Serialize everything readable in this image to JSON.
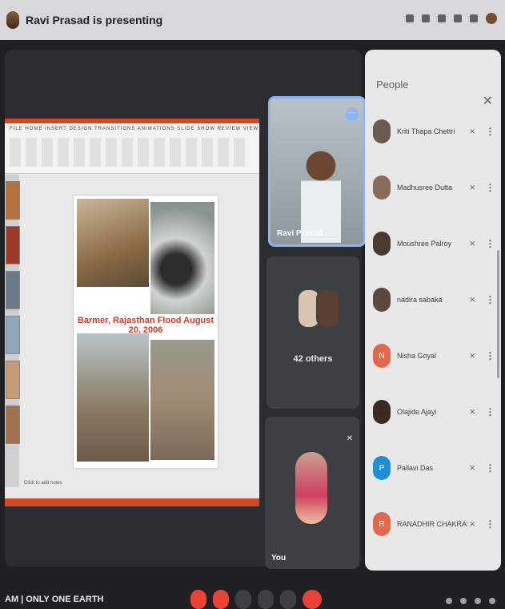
{
  "header": {
    "presenting_text": "Ravi Prasad is presenting"
  },
  "presentation": {
    "ribbon_tabs": "FILE HOME INSERT DESIGN TRANSITIONS ANIMATIONS SLIDE SHOW REVIEW VIEW",
    "slide_title": "Barmer, Rajasthan Flood August 20, 2006",
    "notes_placeholder": "Click to add notes"
  },
  "tiles": {
    "presenter_name": "Ravi Prasad",
    "others_label": "42 others",
    "you_label": "You"
  },
  "people_panel": {
    "title": "People",
    "participants": [
      {
        "name": "Kriti Thapa Chettri",
        "initial": "",
        "color": "#6b5a50"
      },
      {
        "name": "Madhusree Dutta",
        "initial": "",
        "color": "#8a6a5a"
      },
      {
        "name": "Moushree Palroy",
        "initial": "",
        "color": "#4a3a30"
      },
      {
        "name": "nadira sabaka",
        "initial": "",
        "color": "#5a4a3e"
      },
      {
        "name": "Nisha Goyal",
        "initial": "N",
        "color": "#e2674b"
      },
      {
        "name": "Olajide Ajayi",
        "initial": "",
        "color": "#3a2a22"
      },
      {
        "name": "Pallavi Das",
        "initial": "P",
        "color": "#1e8fd6"
      },
      {
        "name": "RANADHIR CHAKRABORTY",
        "initial": "R",
        "color": "#e2674b"
      }
    ]
  },
  "bottom": {
    "clock_text": "AM | ONLY ONE EARTH"
  },
  "colors": {
    "accent": "#8ab4f8",
    "end_call": "#ea4335",
    "powerpoint": "#d24726"
  }
}
